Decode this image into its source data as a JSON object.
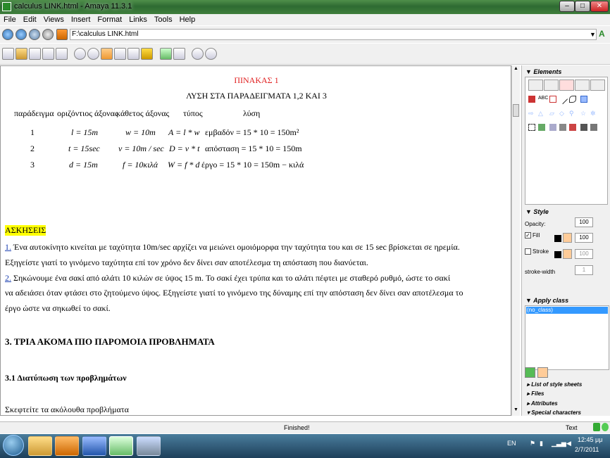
{
  "window": {
    "title": "calculus LINK.html - Amaya 11.3.1",
    "minimize": "–",
    "maximize": "□",
    "close": "✕"
  },
  "menu": [
    "File",
    "Edit",
    "Views",
    "Insert",
    "Format",
    "Links",
    "Tools",
    "Help"
  ],
  "nav": {
    "address": "F:\\calculus LINK.html",
    "icons": [
      "back-icon",
      "forward-icon",
      "reload-icon",
      "stop-icon",
      "home-icon"
    ]
  },
  "toolbar_icons": [
    "new-icon",
    "open-icon",
    "save-icon",
    "save-as-icon",
    "print-icon",
    "undo-icon",
    "redo-icon",
    "cut-icon",
    "copy-icon",
    "paste-icon",
    "css-icon",
    "spellcheck-icon",
    "find-icon",
    "zoom-in-icon",
    "zoom-out-icon"
  ],
  "document": {
    "table_title": "ΠΙΝΑΚΑΣ 1",
    "table_subtitle": "ΛΥΣΗ ΣΤΑ ΠΑΡΑΔΕΙΓΜΑΤΑ 1,2 ΚΑΙ 3",
    "headers": [
      "παράδειγμα",
      "οριζόντιος άξονας",
      "κάθετος άξονας",
      "τύπος",
      "λύση"
    ],
    "rows": [
      [
        "1",
        "l = 15m",
        "w = 10m",
        "A = l * w",
        "εμβαδόν = 15 * 10 = 150m²"
      ],
      [
        "2",
        "t = 15sec",
        "v = 10m / sec",
        "D = v * t",
        "απόσταση = 15 * 10 = 150m"
      ],
      [
        "3",
        "d = 15m",
        "f = 10κιλά",
        "W = f * d",
        "έργο = 15 * 10 = 150m − κιλά"
      ]
    ],
    "exercises_heading": "ΑΣΚΗΣΕΙΣ",
    "ex1_num": "1.",
    "ex1_line1": " Ένα αυτοκίνητο κινείται με ταχύτητα 10m/sec αρχίζει να μειώνει ομοιόμορφα την ταχύτητα του και σε 15 sec βρίσκεται σε ηρεμία.",
    "ex1_line2": "Εξηγείστε γιατί το γινόμενο ταχύτητα επί τον χρόνο δεν δίνει σαν αποτέλεσμα τη απόσταση που διανύεται.",
    "ex2_num": "2.",
    "ex2_line1": " Σηκώνουμε ένα σακί από αλάτι 10 κιλών σε ύψος 15 m. Το σακί έχει τρύπα και το αλάτι πέφτει με σταθερό ρυθμό, ώστε το σακί",
    "ex2_line2": "να αδειάσει όταν φτάσει στο ζητούμενο ύψος. Εξηγείστε γιατί το γινόμενο της δύναμης επί την απόσταση δεν δίνει σαν αποτέλεσμα το",
    "ex2_line3": "έργο ώστε να σηκωθεί το σακί.",
    "section3": "3. ΤΡΙΑ ΑΚΟΜΑ ΠΙΟ ΠΑΡΟΜΟΙΑ ΠΡΟΒΛΗΜΑΤΑ",
    "section31": "3.1 Διατύπωση των προβλημάτων",
    "last_line": "Σκεφτείτε τα ακόλουθα προβλήματα"
  },
  "panel": {
    "elements": "Elements",
    "style": "Style",
    "opacity_label": "Opacity:",
    "opacity": "100",
    "fill_label": "Fill",
    "fill_value": "100",
    "stroke_label": "Stroke",
    "stroke_value": "100",
    "stroke_width_label": "stroke-width",
    "stroke_width": "1",
    "apply_class": "Apply class",
    "no_class": "(no_class)",
    "list_style_sheets": "List of style sheets",
    "files": "Files",
    "attributes": "Attributes",
    "special_characters": "Special characters"
  },
  "status": {
    "message": "Finished!",
    "mode": "Text"
  },
  "taskbar": {
    "lang": "EN",
    "time": "12:45 μμ",
    "date": "2/7/2011"
  },
  "colors": {
    "title_red": "#e02020",
    "highlight": "#ffff00",
    "link": "#1a3fb0",
    "selection": "#3399ff"
  }
}
